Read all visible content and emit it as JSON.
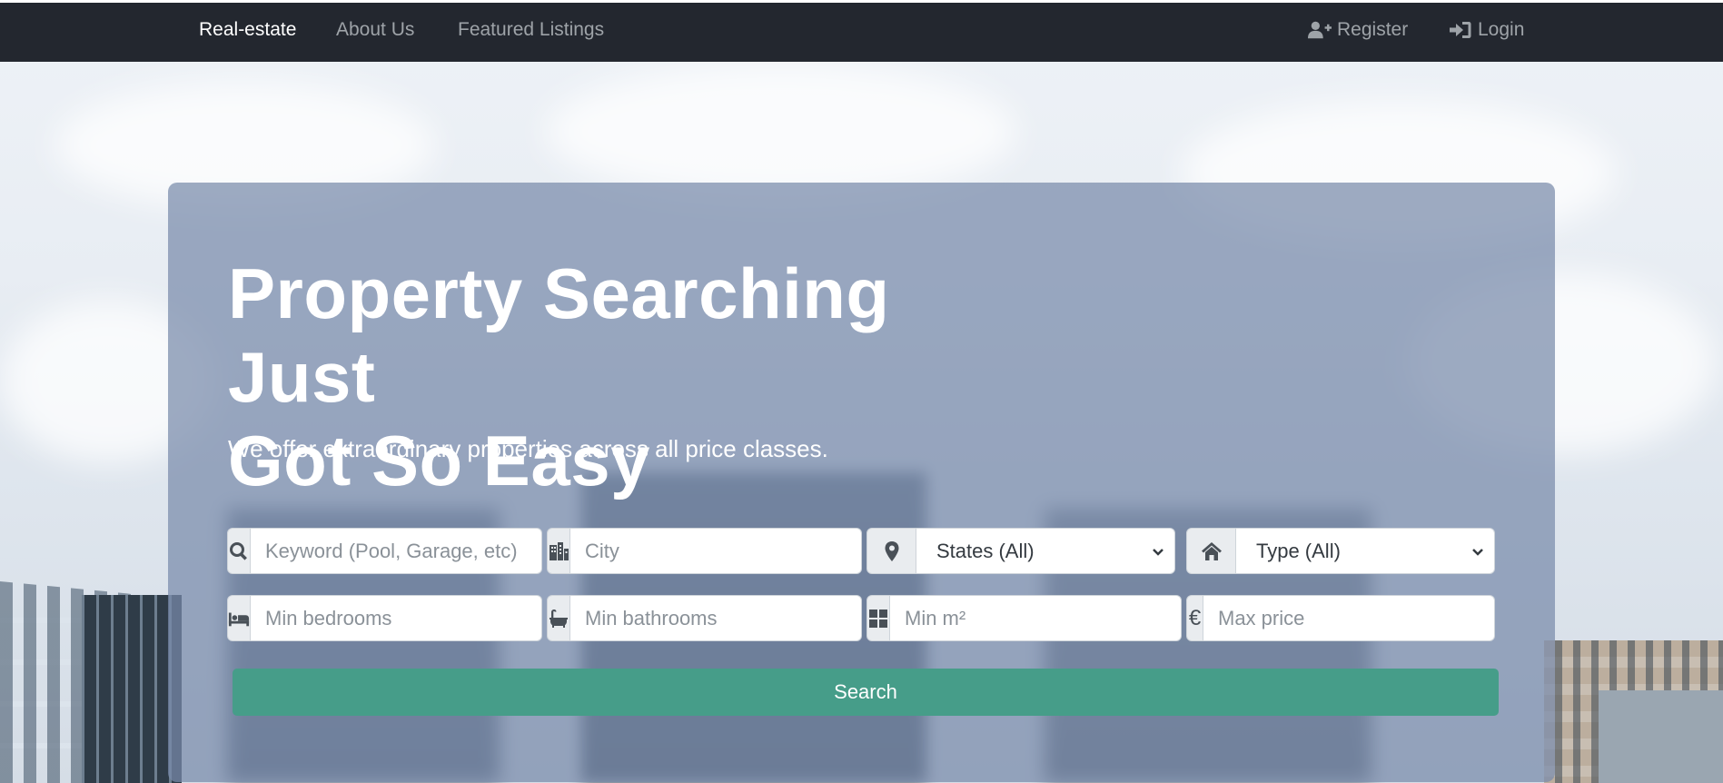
{
  "nav": {
    "brand": "Real-estate",
    "about": "About Us",
    "featured": "Featured Listings",
    "register": "Register",
    "login": "Login"
  },
  "hero": {
    "title_line1": "Property Searching Just",
    "title_line2": "Got So Easy",
    "subtitle": "We offer extraordinary properties across all price classes."
  },
  "search": {
    "keyword_placeholder": "Keyword (Pool, Garage, etc)",
    "city_placeholder": "City",
    "state_selected": "States (All)",
    "type_selected": "Type (All)",
    "bedrooms_placeholder": "Min bedrooms",
    "bathrooms_placeholder": "Min bathrooms",
    "area_placeholder": "Min m²",
    "price_placeholder": "Max price",
    "currency_symbol": "€",
    "button_label": "Search"
  },
  "colors": {
    "navbar": "#23272f",
    "accent_button": "#469d89",
    "panel": "rgba(120,138,170,0.72)"
  },
  "icons": [
    "search-icon",
    "city-icon",
    "location-pin-icon",
    "home-icon",
    "bed-icon",
    "bath-icon",
    "area-grid-icon",
    "euro-icon",
    "user-plus-icon",
    "login-icon",
    "chevron-down-icon"
  ]
}
